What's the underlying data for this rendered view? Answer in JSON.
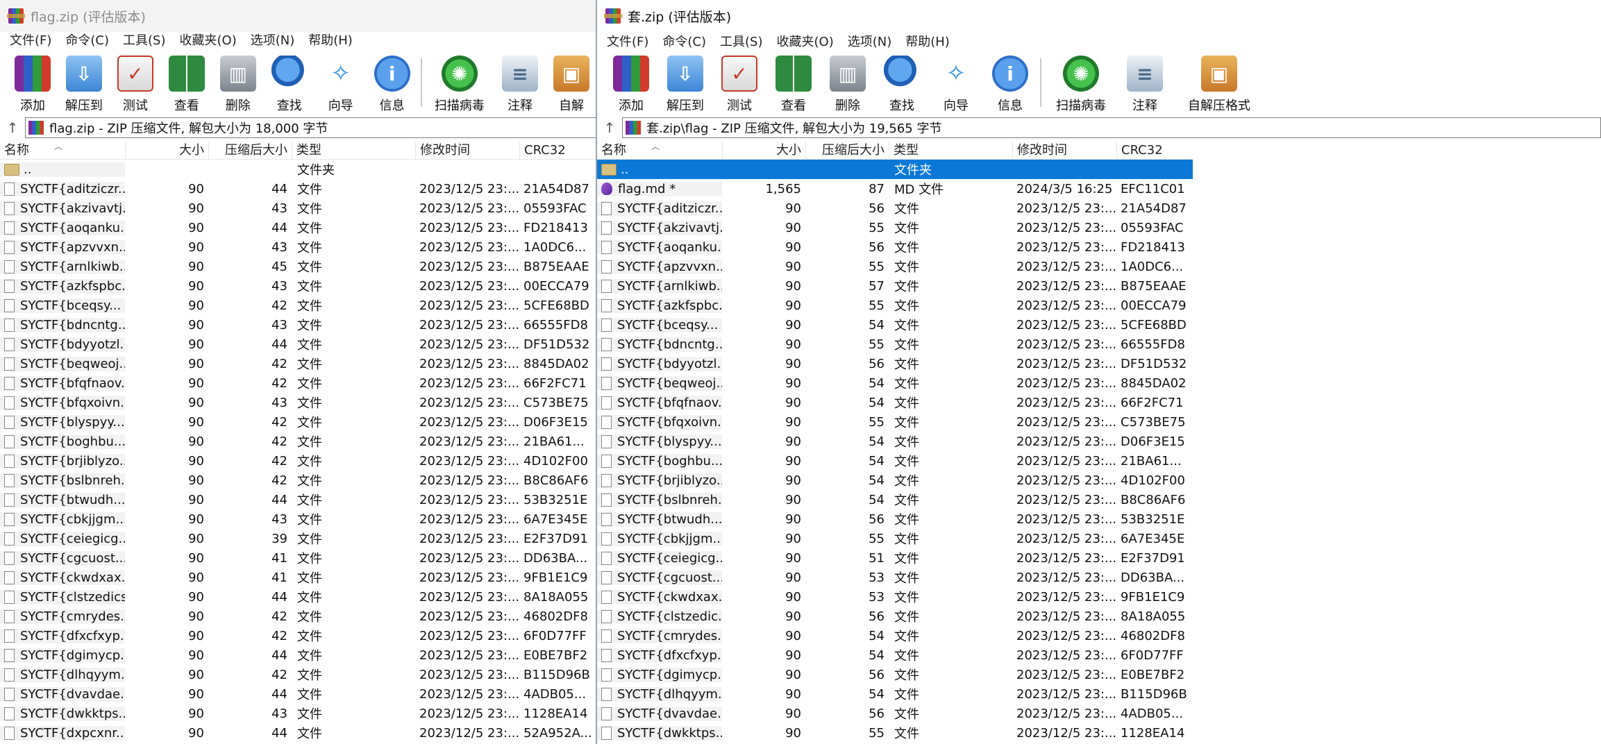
{
  "winA": {
    "title": "flag.zip (评估版本)",
    "menu": [
      "文件(F)",
      "命令(C)",
      "工具(S)",
      "收藏夹(O)",
      "选项(N)",
      "帮助(H)"
    ],
    "tools": [
      {
        "label": "添加",
        "icon": "add-archive-icon"
      },
      {
        "label": "解压到",
        "icon": "extract-to-icon"
      },
      {
        "label": "测试",
        "icon": "test-icon"
      },
      {
        "label": "查看",
        "icon": "view-icon"
      },
      {
        "label": "删除",
        "icon": "delete-icon"
      },
      {
        "label": "查找",
        "icon": "find-icon"
      },
      {
        "label": "向导",
        "icon": "wizard-icon"
      },
      {
        "label": "信息",
        "icon": "info-icon"
      },
      {
        "label": "扫描病毒",
        "icon": "virus-scan-icon"
      },
      {
        "label": "注释",
        "icon": "comment-icon"
      },
      {
        "label": "自解",
        "icon": "sfx-icon"
      }
    ],
    "address": "flag.zip - ZIP 压缩文件, 解包大小为 18,000 字节",
    "columns": [
      "名称",
      "大小",
      "压缩后大小",
      "类型",
      "修改时间",
      "CRC32"
    ],
    "parent_row": {
      "name": "..",
      "type": "文件夹"
    },
    "rows": [
      {
        "name": "SYCTF{aditziczr...",
        "size": "90",
        "csize": "44",
        "type": "文件",
        "time": "2023/12/5 23:...",
        "crc": "21A54D87"
      },
      {
        "name": "SYCTF{akzivavtj...",
        "size": "90",
        "csize": "43",
        "type": "文件",
        "time": "2023/12/5 23:...",
        "crc": "05593FAC"
      },
      {
        "name": "SYCTF{aoqanku...",
        "size": "90",
        "csize": "44",
        "type": "文件",
        "time": "2023/12/5 23:...",
        "crc": "FD218413"
      },
      {
        "name": "SYCTF{apzvvxn...",
        "size": "90",
        "csize": "43",
        "type": "文件",
        "time": "2023/12/5 23:...",
        "crc": "1A0DC6..."
      },
      {
        "name": "SYCTF{arnlkiwb...",
        "size": "90",
        "csize": "45",
        "type": "文件",
        "time": "2023/12/5 23:...",
        "crc": "B875EAAE"
      },
      {
        "name": "SYCTF{azkfspbc...",
        "size": "90",
        "csize": "43",
        "type": "文件",
        "time": "2023/12/5 23:...",
        "crc": "00ECCA79"
      },
      {
        "name": "SYCTF{bceqsy...",
        "size": "90",
        "csize": "42",
        "type": "文件",
        "time": "2023/12/5 23:...",
        "crc": "5CFE68BD"
      },
      {
        "name": "SYCTF{bdncntg...",
        "size": "90",
        "csize": "43",
        "type": "文件",
        "time": "2023/12/5 23:...",
        "crc": "66555FD8"
      },
      {
        "name": "SYCTF{bdyyotzl...",
        "size": "90",
        "csize": "44",
        "type": "文件",
        "time": "2023/12/5 23:...",
        "crc": "DF51D532"
      },
      {
        "name": "SYCTF{beqweoj...",
        "size": "90",
        "csize": "42",
        "type": "文件",
        "time": "2023/12/5 23:...",
        "crc": "8845DA02"
      },
      {
        "name": "SYCTF{bfqfnaov...",
        "size": "90",
        "csize": "42",
        "type": "文件",
        "time": "2023/12/5 23:...",
        "crc": "66F2FC71"
      },
      {
        "name": "SYCTF{bfqxoivn...",
        "size": "90",
        "csize": "43",
        "type": "文件",
        "time": "2023/12/5 23:...",
        "crc": "C573BE75"
      },
      {
        "name": "SYCTF{blyspyy...",
        "size": "90",
        "csize": "42",
        "type": "文件",
        "time": "2023/12/5 23:...",
        "crc": "D06F3E15"
      },
      {
        "name": "SYCTF{boghbu...",
        "size": "90",
        "csize": "42",
        "type": "文件",
        "time": "2023/12/5 23:...",
        "crc": "21BA61..."
      },
      {
        "name": "SYCTF{brjiblyzo...",
        "size": "90",
        "csize": "42",
        "type": "文件",
        "time": "2023/12/5 23:...",
        "crc": "4D102F00"
      },
      {
        "name": "SYCTF{bslbnreh...",
        "size": "90",
        "csize": "42",
        "type": "文件",
        "time": "2023/12/5 23:...",
        "crc": "B8C86AF6"
      },
      {
        "name": "SYCTF{btwudh...",
        "size": "90",
        "csize": "44",
        "type": "文件",
        "time": "2023/12/5 23:...",
        "crc": "53B3251E"
      },
      {
        "name": "SYCTF{cbkjjgm...",
        "size": "90",
        "csize": "43",
        "type": "文件",
        "time": "2023/12/5 23:...",
        "crc": "6A7E345E"
      },
      {
        "name": "SYCTF{ceiegicg...",
        "size": "90",
        "csize": "39",
        "type": "文件",
        "time": "2023/12/5 23:...",
        "crc": "E2F37D91"
      },
      {
        "name": "SYCTF{cgcuost...",
        "size": "90",
        "csize": "41",
        "type": "文件",
        "time": "2023/12/5 23:...",
        "crc": "DD63BA..."
      },
      {
        "name": "SYCTF{ckwdxax...",
        "size": "90",
        "csize": "41",
        "type": "文件",
        "time": "2023/12/5 23:...",
        "crc": "9FB1E1C9"
      },
      {
        "name": "SYCTF{clstzedics}",
        "size": "90",
        "csize": "44",
        "type": "文件",
        "time": "2023/12/5 23:...",
        "crc": "8A18A055"
      },
      {
        "name": "SYCTF{cmrydes...",
        "size": "90",
        "csize": "42",
        "type": "文件",
        "time": "2023/12/5 23:...",
        "crc": "46802DF8"
      },
      {
        "name": "SYCTF{dfxcfxyp...",
        "size": "90",
        "csize": "42",
        "type": "文件",
        "time": "2023/12/5 23:...",
        "crc": "6F0D77FF"
      },
      {
        "name": "SYCTF{dgimycp...",
        "size": "90",
        "csize": "44",
        "type": "文件",
        "time": "2023/12/5 23:...",
        "crc": "E0BE7BF2"
      },
      {
        "name": "SYCTF{dlhqyym...",
        "size": "90",
        "csize": "42",
        "type": "文件",
        "time": "2023/12/5 23:...",
        "crc": "B115D96B"
      },
      {
        "name": "SYCTF{dvavdae...",
        "size": "90",
        "csize": "44",
        "type": "文件",
        "time": "2023/12/5 23:...",
        "crc": "4ADB05..."
      },
      {
        "name": "SYCTF{dwkktps...",
        "size": "90",
        "csize": "43",
        "type": "文件",
        "time": "2023/12/5 23:...",
        "crc": "1128EA14"
      },
      {
        "name": "SYCTF{dxpcxnr...",
        "size": "90",
        "csize": "44",
        "type": "文件",
        "time": "2023/12/5 23:...",
        "crc": "52A952A..."
      }
    ]
  },
  "winB": {
    "title": "套.zip (评估版本)",
    "menu": [
      "文件(F)",
      "命令(C)",
      "工具(S)",
      "收藏夹(O)",
      "选项(N)",
      "帮助(H)"
    ],
    "tools": [
      {
        "label": "添加",
        "icon": "add-archive-icon"
      },
      {
        "label": "解压到",
        "icon": "extract-to-icon"
      },
      {
        "label": "测试",
        "icon": "test-icon"
      },
      {
        "label": "查看",
        "icon": "view-icon"
      },
      {
        "label": "删除",
        "icon": "delete-icon"
      },
      {
        "label": "查找",
        "icon": "find-icon"
      },
      {
        "label": "向导",
        "icon": "wizard-icon"
      },
      {
        "label": "信息",
        "icon": "info-icon"
      },
      {
        "label": "扫描病毒",
        "icon": "virus-scan-icon"
      },
      {
        "label": "注释",
        "icon": "comment-icon"
      },
      {
        "label": "自解压格式",
        "icon": "sfx-icon"
      }
    ],
    "address": "套.zip\\flag - ZIP 压缩文件, 解包大小为 19,565 字节",
    "columns": [
      "名称",
      "大小",
      "压缩后大小",
      "类型",
      "修改时间",
      "CRC32"
    ],
    "parent_row": {
      "name": "..",
      "type": "文件夹"
    },
    "md_row": {
      "name": "flag.md *",
      "size": "1,565",
      "csize": "87",
      "type": "MD 文件",
      "time": "2024/3/5 16:25",
      "crc": "EFC11C01"
    },
    "rows": [
      {
        "name": "SYCTF{aditziczr...",
        "size": "90",
        "csize": "56",
        "type": "文件",
        "time": "2023/12/5 23:...",
        "crc": "21A54D87"
      },
      {
        "name": "SYCTF{akzivavtj...",
        "size": "90",
        "csize": "55",
        "type": "文件",
        "time": "2023/12/5 23:...",
        "crc": "05593FAC"
      },
      {
        "name": "SYCTF{aoqanku...",
        "size": "90",
        "csize": "56",
        "type": "文件",
        "time": "2023/12/5 23:...",
        "crc": "FD218413"
      },
      {
        "name": "SYCTF{apzvvxn...",
        "size": "90",
        "csize": "55",
        "type": "文件",
        "time": "2023/12/5 23:...",
        "crc": "1A0DC6..."
      },
      {
        "name": "SYCTF{arnlkiwb...",
        "size": "90",
        "csize": "57",
        "type": "文件",
        "time": "2023/12/5 23:...",
        "crc": "B875EAAE"
      },
      {
        "name": "SYCTF{azkfspbc...",
        "size": "90",
        "csize": "55",
        "type": "文件",
        "time": "2023/12/5 23:...",
        "crc": "00ECCA79"
      },
      {
        "name": "SYCTF{bceqsy...",
        "size": "90",
        "csize": "54",
        "type": "文件",
        "time": "2023/12/5 23:...",
        "crc": "5CFE68BD"
      },
      {
        "name": "SYCTF{bdncntg...",
        "size": "90",
        "csize": "55",
        "type": "文件",
        "time": "2023/12/5 23:...",
        "crc": "66555FD8"
      },
      {
        "name": "SYCTF{bdyyotzl...",
        "size": "90",
        "csize": "56",
        "type": "文件",
        "time": "2023/12/5 23:...",
        "crc": "DF51D532"
      },
      {
        "name": "SYCTF{beqweoj...",
        "size": "90",
        "csize": "54",
        "type": "文件",
        "time": "2023/12/5 23:...",
        "crc": "8845DA02"
      },
      {
        "name": "SYCTF{bfqfnaov...",
        "size": "90",
        "csize": "54",
        "type": "文件",
        "time": "2023/12/5 23:...",
        "crc": "66F2FC71"
      },
      {
        "name": "SYCTF{bfqxoivn...",
        "size": "90",
        "csize": "55",
        "type": "文件",
        "time": "2023/12/5 23:...",
        "crc": "C573BE75"
      },
      {
        "name": "SYCTF{blyspyy...",
        "size": "90",
        "csize": "54",
        "type": "文件",
        "time": "2023/12/5 23:...",
        "crc": "D06F3E15"
      },
      {
        "name": "SYCTF{boghbu...",
        "size": "90",
        "csize": "54",
        "type": "文件",
        "time": "2023/12/5 23:...",
        "crc": "21BA61..."
      },
      {
        "name": "SYCTF{brjiblyzo...",
        "size": "90",
        "csize": "54",
        "type": "文件",
        "time": "2023/12/5 23:...",
        "crc": "4D102F00"
      },
      {
        "name": "SYCTF{bslbnreh...",
        "size": "90",
        "csize": "54",
        "type": "文件",
        "time": "2023/12/5 23:...",
        "crc": "B8C86AF6"
      },
      {
        "name": "SYCTF{btwudh...",
        "size": "90",
        "csize": "56",
        "type": "文件",
        "time": "2023/12/5 23:...",
        "crc": "53B3251E"
      },
      {
        "name": "SYCTF{cbkjjgm...",
        "size": "90",
        "csize": "55",
        "type": "文件",
        "time": "2023/12/5 23:...",
        "crc": "6A7E345E"
      },
      {
        "name": "SYCTF{ceiegicg...",
        "size": "90",
        "csize": "51",
        "type": "文件",
        "time": "2023/12/5 23:...",
        "crc": "E2F37D91"
      },
      {
        "name": "SYCTF{cgcuost...",
        "size": "90",
        "csize": "53",
        "type": "文件",
        "time": "2023/12/5 23:...",
        "crc": "DD63BA..."
      },
      {
        "name": "SYCTF{ckwdxax...",
        "size": "90",
        "csize": "53",
        "type": "文件",
        "time": "2023/12/5 23:...",
        "crc": "9FB1E1C9"
      },
      {
        "name": "SYCTF{clstzedic...",
        "size": "90",
        "csize": "56",
        "type": "文件",
        "time": "2023/12/5 23:...",
        "crc": "8A18A055"
      },
      {
        "name": "SYCTF{cmrydes...",
        "size": "90",
        "csize": "54",
        "type": "文件",
        "time": "2023/12/5 23:...",
        "crc": "46802DF8"
      },
      {
        "name": "SYCTF{dfxcfxyp...",
        "size": "90",
        "csize": "54",
        "type": "文件",
        "time": "2023/12/5 23:...",
        "crc": "6F0D77FF"
      },
      {
        "name": "SYCTF{dgimycp...",
        "size": "90",
        "csize": "56",
        "type": "文件",
        "time": "2023/12/5 23:...",
        "crc": "E0BE7BF2"
      },
      {
        "name": "SYCTF{dlhqyym...",
        "size": "90",
        "csize": "54",
        "type": "文件",
        "time": "2023/12/5 23:...",
        "crc": "B115D96B"
      },
      {
        "name": "SYCTF{dvavdae...",
        "size": "90",
        "csize": "56",
        "type": "文件",
        "time": "2023/12/5 23:...",
        "crc": "4ADB05..."
      },
      {
        "name": "SYCTF{dwkktps...",
        "size": "90",
        "csize": "55",
        "type": "文件",
        "time": "2023/12/5 23:...",
        "crc": "1128EA14"
      }
    ]
  },
  "colors": {
    "selection": "#0b78d7",
    "name_column_bg": "#f2f2f2"
  }
}
